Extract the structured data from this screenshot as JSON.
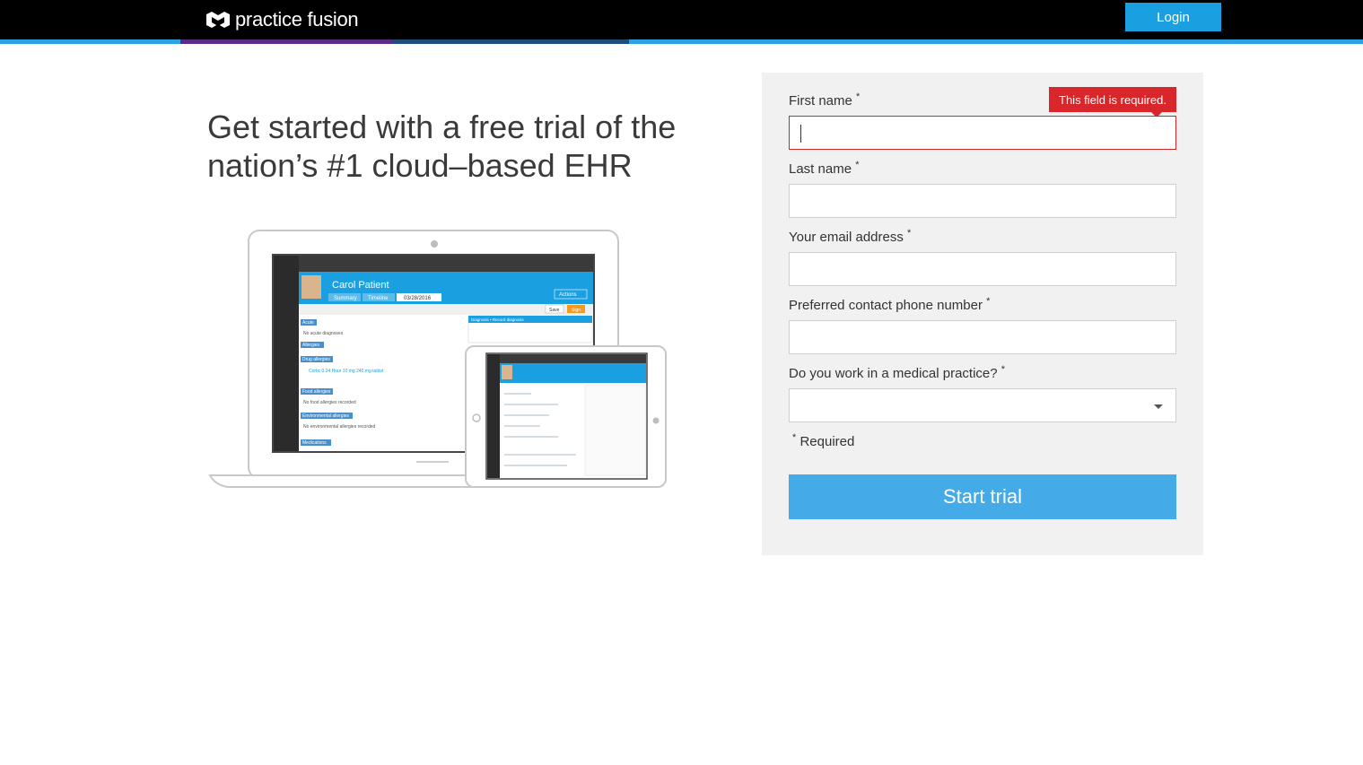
{
  "header": {
    "logo_text": "practice fusion",
    "logo_icon": "practice-fusion-logo-icon",
    "login_label": "Login",
    "colors": {
      "bar": "#000000",
      "accent": "#2aa3e0",
      "purple": "#5b2c83",
      "navy": "#1f4d7a"
    }
  },
  "hero": {
    "headline": "Get started with a free trial of the nation’s #1 cloud–based EHR"
  },
  "device_preview": {
    "patient_name": "Carol Patient",
    "tabs": [
      "Summary",
      "Timeline"
    ],
    "date": "03/28/2016",
    "actions_label": "Actions",
    "save_label": "Save",
    "sign_label": "Sign",
    "sections": [
      {
        "title": "Acute",
        "text": "No acute diagnoses"
      },
      {
        "title": "Allergies",
        "text": ""
      },
      {
        "title": "Drug allergies",
        "text": "Cortic 0.24 Hour 10 mg 240 mg tablet"
      },
      {
        "title": "Food allergies",
        "text": "No food allergies recorded"
      },
      {
        "title": "Environmental allergies",
        "text": "No environmental allergies recorded"
      },
      {
        "title": "Medications",
        "text": ""
      }
    ],
    "panel_title": "Diagnosis • Record diagnosis"
  },
  "form": {
    "first_name": {
      "label": "First name",
      "value": "",
      "error": "This field is required."
    },
    "last_name": {
      "label": "Last name",
      "value": ""
    },
    "email": {
      "label": "Your email address",
      "value": ""
    },
    "phone": {
      "label": "Preferred contact phone number",
      "value": ""
    },
    "medical_practice": {
      "label": "Do you work in a medical practice?",
      "value": ""
    },
    "required_asterisk": "*",
    "required_note": "Required",
    "submit_label": "Start trial",
    "colors": {
      "panel_bg": "#f1f1f1",
      "button": "#45aae8",
      "error": "#d9262b"
    }
  }
}
